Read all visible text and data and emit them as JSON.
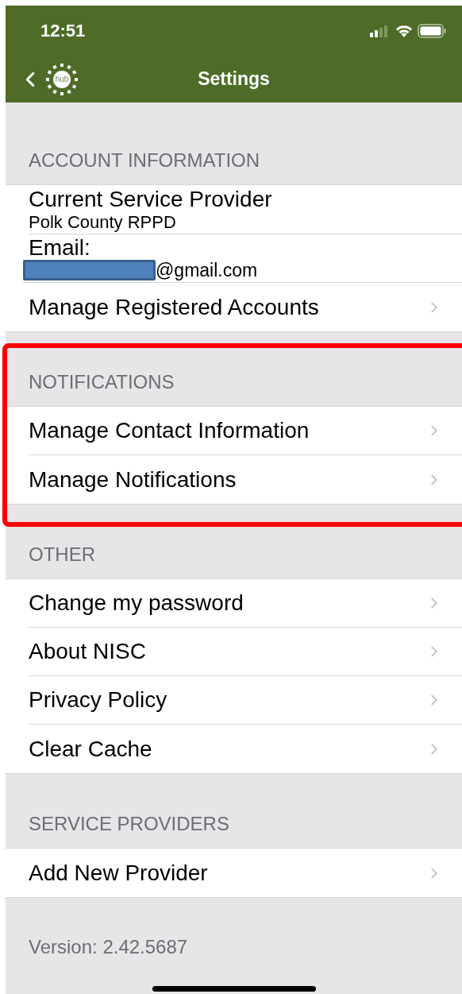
{
  "status_bar": {
    "time": "12:51"
  },
  "nav": {
    "title": "Settings",
    "logo_text": "hub"
  },
  "sections": [
    {
      "header": "ACCOUNT INFORMATION",
      "highlighted": false,
      "items": [
        {
          "kind": "info",
          "label": "Current Service Provider",
          "value": "Polk County RPPD"
        },
        {
          "kind": "email",
          "label": "Email:",
          "address": "@gmail.com",
          "redacted": true
        },
        {
          "kind": "link",
          "label": "Manage Registered Accounts"
        }
      ]
    },
    {
      "header": "NOTIFICATIONS",
      "highlighted": true,
      "items": [
        {
          "kind": "link",
          "label": "Manage Contact Information"
        },
        {
          "kind": "link",
          "label": "Manage Notifications"
        }
      ]
    },
    {
      "header": "OTHER",
      "highlighted": false,
      "items": [
        {
          "kind": "link",
          "label": "Change my password"
        },
        {
          "kind": "link",
          "label": "About NISC"
        },
        {
          "kind": "link",
          "label": "Privacy Policy"
        },
        {
          "kind": "link",
          "label": "Clear Cache"
        }
      ]
    },
    {
      "header": "SERVICE PROVIDERS",
      "highlighted": false,
      "items": [
        {
          "kind": "link",
          "label": "Add New Provider"
        }
      ]
    }
  ],
  "version": "Version: 2.42.5687"
}
